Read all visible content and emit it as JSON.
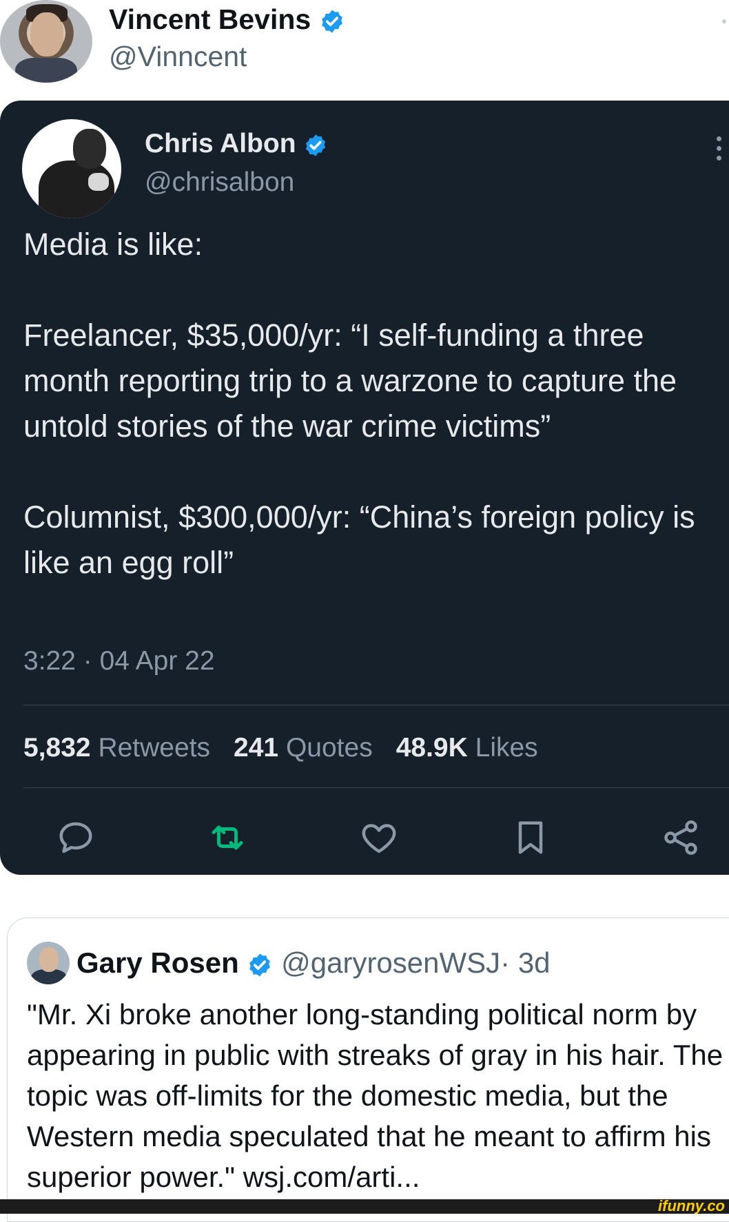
{
  "author": {
    "name": "Vincent Bevins",
    "handle": "@Vinncent"
  },
  "quoted_tweet": {
    "author_name": "Chris Albon",
    "author_handle": "@chrisalbon",
    "text": "Media is like:\n\nFreelancer, $35,000/yr: “I self-funding a three month reporting trip to a warzone to capture the untold stories of the war crime victims”\n\nColumnist, $300,000/yr: “China’s foreign policy is like an egg roll”",
    "timestamp": "3:22 · 04 Apr 22",
    "stats": {
      "retweets_count": "5,832",
      "retweets_label": "Retweets",
      "quotes_count": "241",
      "quotes_label": "Quotes",
      "likes_count": "48.9K",
      "likes_label": "Likes"
    },
    "actions": [
      "reply-icon",
      "retweet-icon",
      "like-icon",
      "bookmark-icon",
      "share-icon"
    ]
  },
  "embedded_tweet": {
    "author_name": "Gary Rosen",
    "author_handle": "@garyrosenWSJ",
    "age": "· 3d",
    "text": "\"Mr. Xi broke another long-standing political norm by appearing in public with streaks of gray in his hair. The topic was off-limits for the domestic media, but the Western media speculated that he meant to affirm his superior power.\" wsj.com/arti..."
  },
  "watermark": "ifunny.co",
  "colors": {
    "verified": "#1d9bf0",
    "dark_card": "#15202b",
    "retweet_green": "#00ba7c",
    "muted_dark": "#8b98a5",
    "muted_light": "#536471"
  }
}
